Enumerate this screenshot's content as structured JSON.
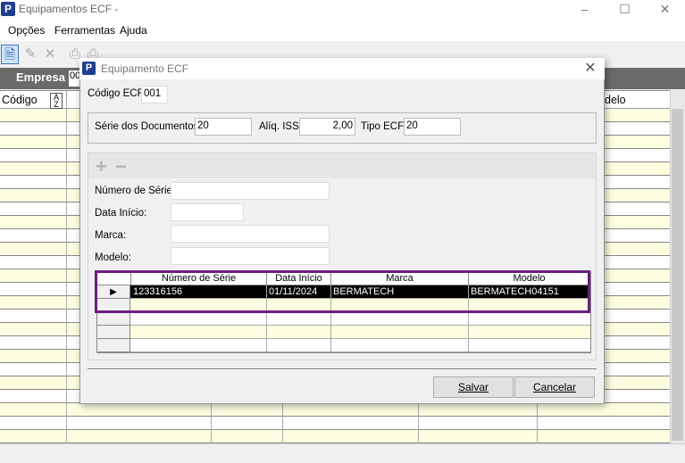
{
  "window": {
    "title": "Equipamentos ECF -",
    "icon_letter": "P",
    "minimize": "–",
    "maximize": "☐",
    "close": "✕"
  },
  "menu": [
    "Opções",
    "Ferramentas",
    "Ajuda"
  ],
  "empresa": {
    "label": "Empresa",
    "value": "00"
  },
  "bg_grid": {
    "col_codigo": "Código",
    "col_modelo": "delo",
    "sort_icon": "A↓Z"
  },
  "dialog": {
    "title": "Equipamento ECF",
    "icon_letter": "P",
    "close": "✕",
    "codigo_label": "Código ECF:",
    "codigo_value": "001",
    "serie_doc_label": "Série dos Documentos:",
    "serie_doc_value": "20",
    "aliq_iss_label": "Alíq. ISS:",
    "aliq_iss_value": "2,00",
    "tipo_ecf_label": "Tipo ECF:",
    "tipo_ecf_value": "20",
    "plus": "+",
    "minus": "−",
    "numero_serie_label": "Número de Série:",
    "data_inicio_label": "Data Início:",
    "marca_label": "Marca:",
    "modelo_label": "Modelo:",
    "grid": {
      "headers": [
        "Número de Série",
        "Data Início",
        "Marca",
        "Modelo"
      ],
      "rows": [
        [
          "123316156",
          "01/11/2024",
          "BERMATECH",
          "BERMATECH04151"
        ]
      ],
      "current_row_marker": "▶"
    },
    "save_button": "Salvar",
    "cancel_button": "Cancelar"
  },
  "colors": {
    "highlight_border": "#6a1f7c",
    "selected_row_bg": "#000000",
    "grid_alt_row": "#fdfde0"
  }
}
